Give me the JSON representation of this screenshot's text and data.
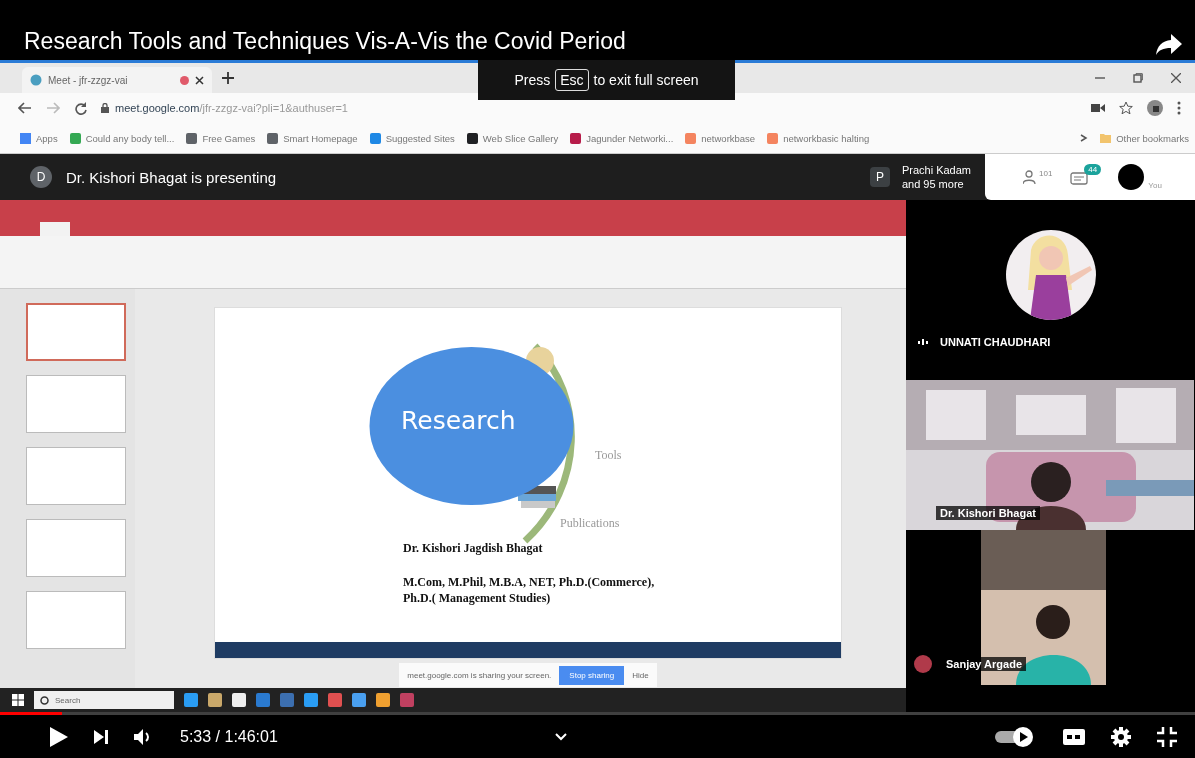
{
  "video_title": "Research Tools and Techniques Vis-A-Vis the Covid Period",
  "fullscreen_hint": {
    "before": "Press",
    "key": "Esc",
    "after": "to exit full screen"
  },
  "browser": {
    "tab_title": "Meet - jfr-zzgz-vai",
    "recording": true,
    "address_host": "meet.google.com",
    "address_path": "/jfr-zzgz-vai?pli=1&authuser=1",
    "bookmarks": [
      {
        "label": "Apps",
        "color": "#4285f4"
      },
      {
        "label": "Could any body tell...",
        "color": "#34a853"
      },
      {
        "label": "Free Games",
        "color": "#5f6368"
      },
      {
        "label": "Smart Homepage",
        "color": "#5f6368"
      },
      {
        "label": "Suggested Sites",
        "color": "#1e88e5"
      },
      {
        "label": "Web Slice Gallery",
        "color": "#202124"
      },
      {
        "label": "Jagunder Networki...",
        "color": "#b71c4a"
      },
      {
        "label": "networkbase",
        "color": "#f4845f"
      },
      {
        "label": "networkbasic halting",
        "color": "#f4845f"
      }
    ],
    "other_bookmarks": "Other bookmarks"
  },
  "meet": {
    "presenter_initial": "D",
    "presenting": "Dr. Kishori Bhagat is presenting",
    "participant_initial": "P",
    "participants_name": "Prachi Kadam",
    "participants_more": "and 95 more",
    "people_count": "101",
    "chat_count": "44",
    "you_label": "You"
  },
  "slides": {
    "thumbnails": [
      {
        "selected": true
      },
      {
        "selected": false
      },
      {
        "selected": false
      },
      {
        "selected": false
      },
      {
        "selected": false
      }
    ],
    "center_label": "Research",
    "labels": [
      "Tools",
      "Publications"
    ],
    "author": "Dr. Kishori Jagdish Bhagat",
    "qualifications": [
      "M.Com, M.Phil, M.B.A, NET, Ph.D.(Commerce),",
      "Ph.D.( Management Studies)"
    ],
    "sharing_notice": "meet.google.com is sharing your screen.",
    "stop_button": "Stop sharing",
    "hide_button": "Hide"
  },
  "taskbar": {
    "search": "Search"
  },
  "tiles": [
    {
      "kind": "avatar",
      "name": "UNNATI CHAUDHARI"
    },
    {
      "kind": "video",
      "name": "Dr. Kishori Bhagat"
    },
    {
      "kind": "video_small",
      "name": "Sanjay Argade"
    }
  ],
  "player": {
    "time": "5:33 / 1:46:01",
    "progress": {
      "level": 0.052
    },
    "autoplay": {
      "on": true
    }
  }
}
